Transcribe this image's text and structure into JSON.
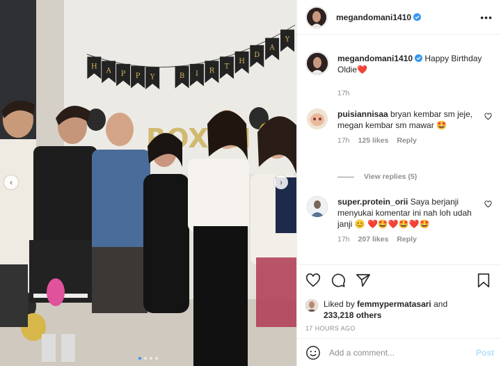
{
  "post": {
    "username": "megandomani1410",
    "more_icon": "more-horizontal-icon",
    "caption": {
      "username": "megandomani1410",
      "text": "Happy Birthday Oldie",
      "emoji": "❤️",
      "time": "17h"
    },
    "photo": {
      "banner_letters": [
        "H",
        "A",
        "P",
        "P",
        "Y",
        "B",
        "I",
        "R",
        "T",
        "H",
        "D",
        "A",
        "Y"
      ],
      "balloon_text": "ROXAN",
      "slide_count": 4,
      "active_slide": 1
    },
    "comments": [
      {
        "username": "puisiannisaa",
        "text": "bryan kembar sm jeje, megan kembar sm mawar",
        "emoji": "🤩",
        "time": "17h",
        "likes": "125 likes",
        "reply": "Reply",
        "view_replies": "View replies (5)"
      },
      {
        "username": "super.protein_orii",
        "text": "Saya berjanji menyukai komentar ini nah loh udah janji",
        "emoji_tail": "😊 ❤️🤩❤️🤩❤️🤩",
        "time": "17h",
        "likes": "207 likes",
        "reply": "Reply"
      }
    ],
    "liked_by": {
      "prefix": "Liked by",
      "user": "femmypermatasari",
      "and": "and",
      "others": "233,218 others"
    },
    "timestamp": "17 HOURS AGO",
    "comment_box": {
      "placeholder": "Add a comment...",
      "post_label": "Post"
    },
    "colors": {
      "verified": "#3897f0",
      "heart": "#ed4956",
      "post_disabled": "#b2dffc"
    }
  }
}
